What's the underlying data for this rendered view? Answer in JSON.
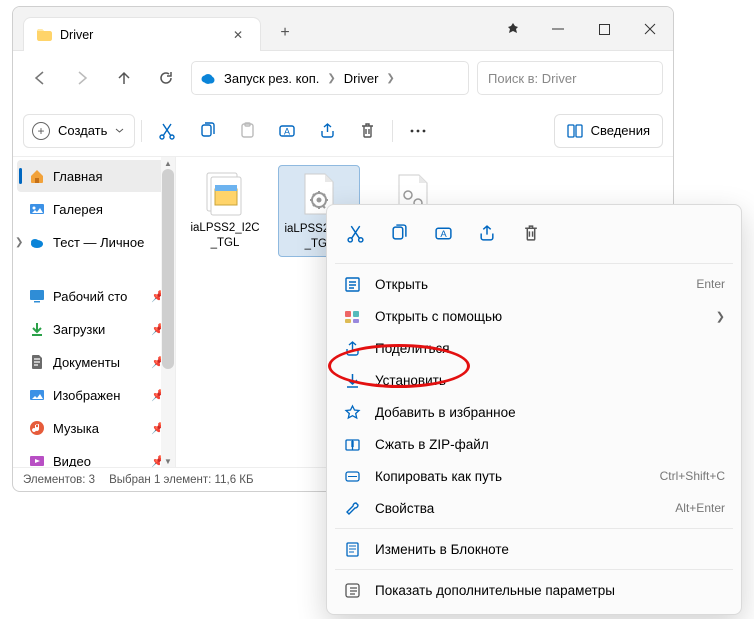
{
  "titlebar": {
    "tab_label": "Driver"
  },
  "breadcrumb": {
    "root": "Запуск рез. коп.",
    "folder": "Driver"
  },
  "search": {
    "placeholder": "Поиск в: Driver"
  },
  "toolbar": {
    "new_label": "Создать",
    "details_label": "Сведения"
  },
  "sidebar": {
    "home": "Главная",
    "gallery": "Галерея",
    "tests": "Тест — Личное",
    "desktop": "Рабочий сто",
    "downloads": "Загрузки",
    "documents": "Документы",
    "pictures": "Изображен",
    "music": "Музыка",
    "videos": "Видео"
  },
  "files": {
    "f1": "iaLPSS2_I2C_TGL",
    "f2": "iaLPSS2_I2C_TGL",
    "f3": ""
  },
  "status": {
    "count": "Элементов: 3",
    "sel": "Выбран 1 элемент: 11,6 КБ"
  },
  "ctx": {
    "open": "Открыть",
    "open_short": "Enter",
    "openwith": "Открыть с помощью",
    "share": "Поделиться",
    "install": "Установить",
    "fav": "Добавить в избранное",
    "zip": "Сжать в ZIP-файл",
    "copypath": "Копировать как путь",
    "copypath_short": "Ctrl+Shift+C",
    "props": "Свойства",
    "props_short": "Alt+Enter",
    "notepad": "Изменить в Блокноте",
    "more": "Показать дополнительные параметры"
  }
}
